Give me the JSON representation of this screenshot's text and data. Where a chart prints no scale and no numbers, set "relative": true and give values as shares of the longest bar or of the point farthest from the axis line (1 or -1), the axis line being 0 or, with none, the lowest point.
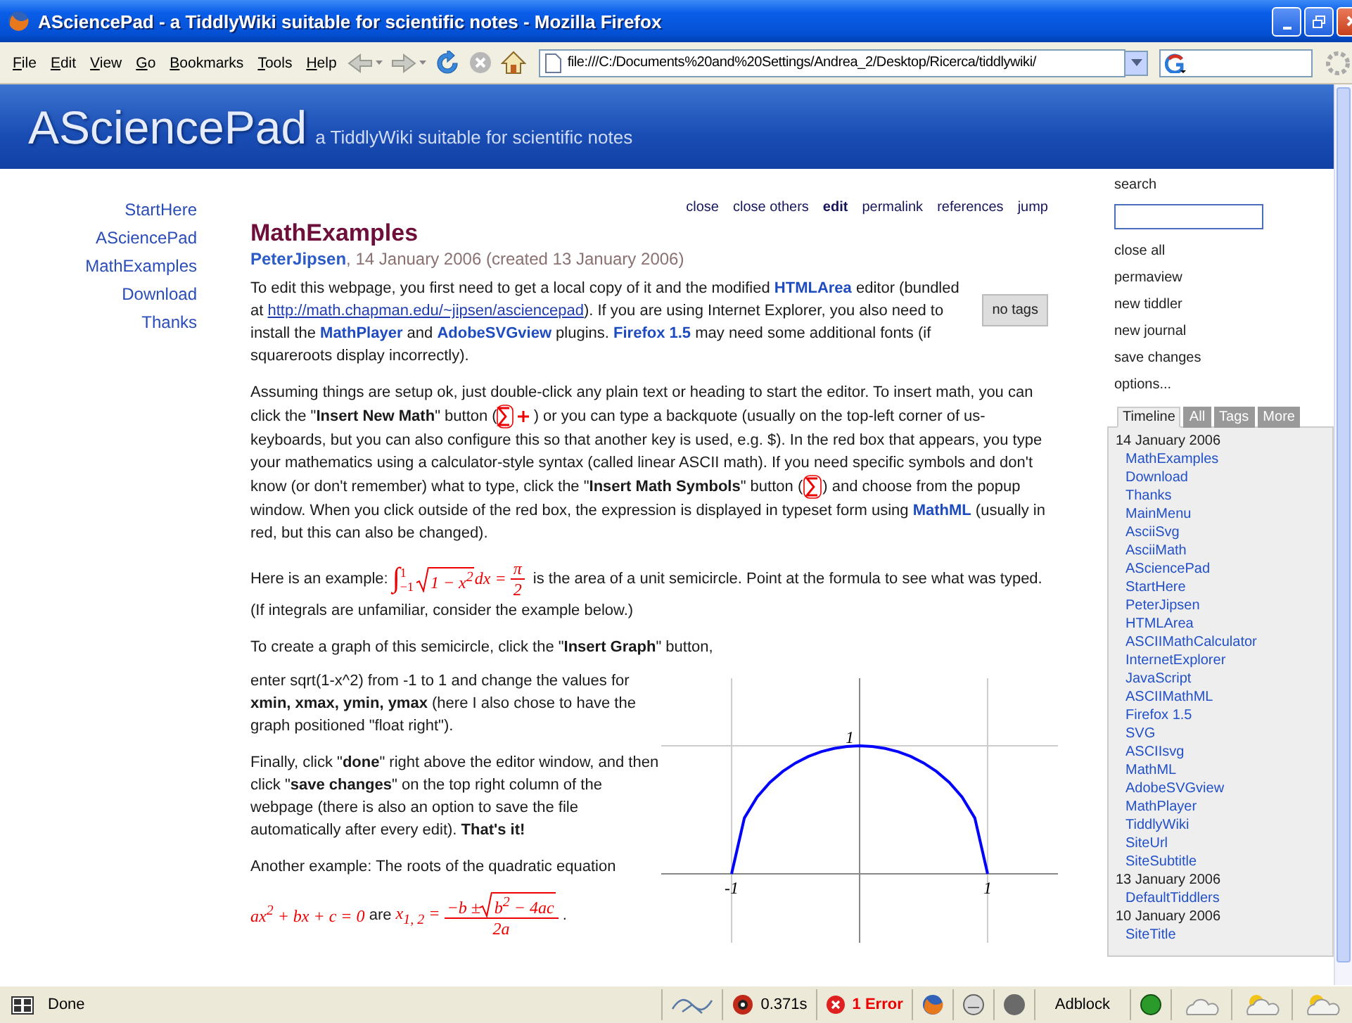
{
  "window": {
    "title": "ASciencePad - a TiddlyWiki suitable for scientific notes - Mozilla Firefox"
  },
  "menu": [
    "File",
    "Edit",
    "View",
    "Go",
    "Bookmarks",
    "Tools",
    "Help"
  ],
  "address": {
    "value": "file:///C:/Documents%20and%20Settings/Andrea_2/Desktop/Ricerca/tiddlywiki/"
  },
  "site": {
    "title": "ASciencePad",
    "subtitle": "a TiddlyWiki suitable for scientific notes"
  },
  "main_menu": [
    "StartHere",
    "ASciencePad",
    "MathExamples",
    "Download",
    "Thanks"
  ],
  "tiddler": {
    "toolbar": [
      {
        "label": "close",
        "emphasized": false
      },
      {
        "label": "close others",
        "emphasized": false
      },
      {
        "label": "edit",
        "emphasized": true
      },
      {
        "label": "permalink",
        "emphasized": false
      },
      {
        "label": "references",
        "emphasized": false
      },
      {
        "label": "jump",
        "emphasized": false
      }
    ],
    "title": "MathExamples",
    "modifier": "PeterJipsen",
    "dates": ", 14 January 2006 (created 13 January 2006)",
    "tags_button": "no tags",
    "paragraphs": [
      [
        {
          "kind": "text",
          "text": "To edit this webpage, you first need to get a local copy of it and the modified "
        },
        {
          "kind": "link",
          "text": "HTMLArea"
        },
        {
          "kind": "text",
          "text": " editor (bundled at "
        },
        {
          "kind": "url",
          "text": "http://math.chapman.edu/~jipsen/asciencepad"
        },
        {
          "kind": "text",
          "text": "). If you are using Internet Explorer, you also need to install the "
        },
        {
          "kind": "link",
          "text": "MathPlayer"
        },
        {
          "kind": "text",
          "text": " and "
        },
        {
          "kind": "link",
          "text": "AdobeSVGview"
        },
        {
          "kind": "text",
          "text": " plugins. "
        },
        {
          "kind": "link",
          "text": "Firefox 1.5"
        },
        {
          "kind": "text",
          "text": " may need some additional fonts (if squareroots display incorrectly)."
        }
      ],
      [
        {
          "kind": "text",
          "text": "Assuming things are setup ok, just double-click any plain text or heading to start the editor. To insert math, you can click the \"**Insert New Math**\" button ("
        },
        {
          "kind": "sigma-plus-icon"
        },
        {
          "kind": "text",
          "text": ") or you can type a backquote (usually on the top-left corner of us-keyboards, but you can also configure this so that another key is used, e.g. $). In the red box that appears, you type your mathematics using a calculator-style syntax (called linear ASCII math). If you need specific symbols and don't know (or don't remember) what to type, click the \"**Insert Math Symbols**\" button ("
        },
        {
          "kind": "sigma-icon"
        },
        {
          "kind": "text",
          "text": ")  and choose from the popup window. When you click outside of the red box, the expression is displayed in typeset form using "
        },
        {
          "kind": "link",
          "text": "MathML"
        },
        {
          "kind": "text",
          "text": " (usually in red, but this can also be changed)."
        }
      ],
      [
        {
          "kind": "text",
          "text": "Here is an example: "
        },
        {
          "kind": "math",
          "tokens": [
            {
              "kind": "int",
              "sign": "∫",
              "upper": "1",
              "lower": "−1"
            },
            {
              "kind": "sqrt",
              "body": [
                {
                  "kind": "text",
                  "text": "1 − x$^{2}$"
                }
              ]
            },
            {
              "kind": "text",
              "text": "dx ="
            },
            {
              "kind": "frac",
              "num": [
                {
                  "kind": "text",
                  "text": "π"
                }
              ],
              "den": [
                {
                  "kind": "text",
                  "text": "2"
                }
              ]
            }
          ]
        },
        {
          "kind": "text",
          "text": " is the area of a unit semicircle. Point at the formula to see what was typed. (If integrals are unfamiliar, consider the example below.)"
        }
      ],
      [
        {
          "kind": "text",
          "text": "To create a graph of this semicircle, click the \"**Insert Graph**\" button,"
        }
      ]
    ],
    "graph_block": {
      "paragraphs": [
        [
          {
            "kind": "text",
            "text": "enter sqrt(1-x^2) from -1 to 1 and change the values for **xmin, xmax, ymin, ymax** (here I also chose to have the graph positioned \"float right\")."
          }
        ],
        [
          {
            "kind": "text",
            "text": "Finally, click \"**done**\" right above the editor window, and then click \"**save changes**\" on the top right column of the webpage (there is also an option to save the file automatically after every edit). **That's it!**"
          }
        ],
        [
          {
            "kind": "text",
            "text": "Another example: The roots of the quadratic equation"
          }
        ],
        [
          {
            "kind": "math",
            "tokens": [
              {
                "kind": "text",
                "text": "ax$^{2}$ + bx + c = 0"
              }
            ]
          },
          {
            "kind": "text",
            "text": " are "
          },
          {
            "kind": "math",
            "tokens": [
              {
                "kind": "text",
                "text": "x$_{1, 2}$ ="
              },
              {
                "kind": "frac",
                "num": [
                  {
                    "kind": "text",
                    "text": "−b ±"
                  },
                  {
                    "kind": "sqrt",
                    "body": [
                      {
                        "kind": "text",
                        "text": "b$^{2}$ − 4ac"
                      }
                    ]
                  }
                ],
                "den": [
                  {
                    "kind": "text",
                    "text": "2a"
                  }
                ]
              }
            ]
          },
          {
            "kind": "text",
            "text": "."
          }
        ]
      ],
      "chart_data": {
        "type": "line",
        "x": [
          -1,
          -0.9,
          -0.8,
          -0.7,
          -0.6,
          -0.5,
          -0.4,
          -0.3,
          -0.2,
          -0.1,
          0,
          0.1,
          0.2,
          0.3,
          0.4,
          0.5,
          0.6,
          0.7,
          0.8,
          0.9,
          1
        ],
        "series": [
          {
            "color": "#0000ff",
            "values": [
              0,
              0.436,
              0.6,
              0.714,
              0.8,
              0.866,
              0.917,
              0.954,
              0.98,
              0.995,
              1,
              0.995,
              0.98,
              0.954,
              0.917,
              0.866,
              0.8,
              0.714,
              0.6,
              0.436,
              0
            ]
          }
        ],
        "xlim": [
          -1.55,
          1.55
        ],
        "xticks": [
          -1,
          1
        ],
        "relative": true,
        "annotations": [
          {
            "text": "1",
            "x": 0,
            "y": 1
          }
        ]
      }
    }
  },
  "sidebar": {
    "search_label": "search",
    "commands": [
      "close all",
      "permaview",
      "new tiddler",
      "new journal",
      "save changes",
      "options..."
    ],
    "tabs": [
      {
        "label": "Timeline",
        "selected": true
      },
      {
        "label": "All",
        "selected": false
      },
      {
        "label": "Tags",
        "selected": false
      },
      {
        "label": "More",
        "selected": false
      }
    ],
    "timeline": [
      {
        "date": "14 January 2006",
        "children": [
          "MathExamples",
          "Download",
          "Thanks",
          "MainMenu",
          "AsciiSvg",
          "AsciiMath",
          "ASciencePad",
          "StartHere",
          "PeterJipsen",
          "HTMLArea",
          "ASCIIMathCalculator",
          "InternetExplorer",
          "JavaScript",
          "ASCIIMathML",
          "Firefox 1.5",
          "SVG",
          "ASCIIsvg",
          "MathML",
          "AdobeSVGview",
          "MathPlayer",
          "TiddlyWiki",
          "SiteUrl",
          "SiteSubtitle"
        ]
      },
      {
        "date": "13 January 2006",
        "children": [
          "DefaultTiddlers"
        ]
      },
      {
        "date": "10 January 2006",
        "children": [
          "SiteTitle"
        ]
      }
    ]
  },
  "status_bar": {
    "text": "Done",
    "timing": "0.371s",
    "errors": "1 Error",
    "adblock": "Adblock"
  }
}
